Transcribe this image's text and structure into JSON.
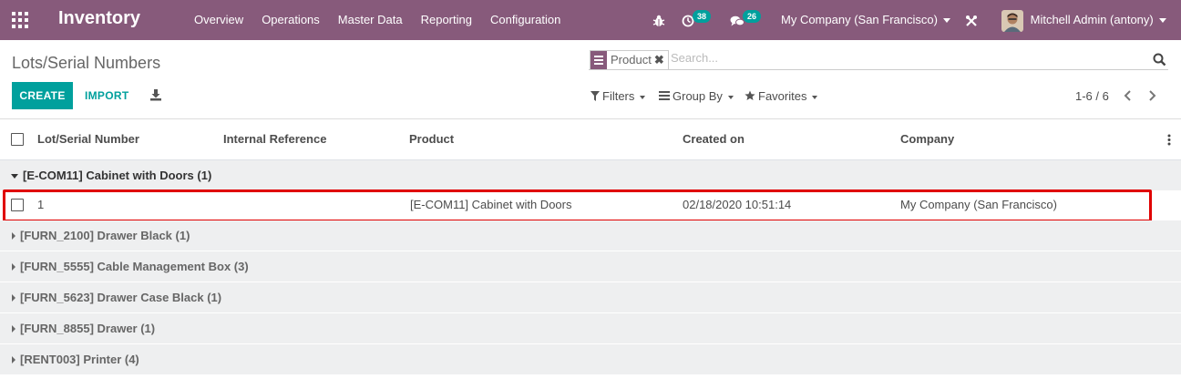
{
  "navbar": {
    "app_name": "Inventory",
    "menu": [
      "Overview",
      "Operations",
      "Master Data",
      "Reporting",
      "Configuration"
    ],
    "activity_badge": "38",
    "messages_badge": "26",
    "company": "My Company (San Francisco)",
    "user": "Mitchell Admin (antony)"
  },
  "control_panel": {
    "breadcrumb": "Lots/Serial Numbers",
    "search": {
      "facet_value": "Product",
      "placeholder": "Search..."
    },
    "create_label": "CREATE",
    "import_label": "IMPORT",
    "filters_label": "Filters",
    "groupby_label": "Group By",
    "favorites_label": "Favorites",
    "pager": "1-6 / 6"
  },
  "table": {
    "columns": [
      "Lot/Serial Number",
      "Internal Reference",
      "Product",
      "Created on",
      "Company"
    ],
    "groups": [
      "[E-COM11] Cabinet with Doors (1)",
      "[FURN_2100] Drawer Black (1)",
      "[FURN_5555] Cable Management Box (3)",
      "[FURN_5623] Drawer Case Black (1)",
      "[FURN_8855] Drawer (1)",
      "[RENT003] Printer (4)"
    ],
    "expanded_row": {
      "lot": "1",
      "internal_ref": "",
      "product": "[E-COM11] Cabinet with Doors",
      "created_on": "02/18/2020 10:51:14",
      "company": "My Company (San Francisco)"
    }
  },
  "colors": {
    "navbar": "#875a7b",
    "primary": "#00a09d",
    "highlight": "#e00000"
  }
}
